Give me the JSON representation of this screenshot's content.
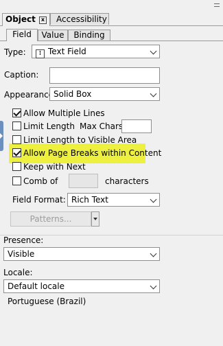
{
  "tabs": {
    "object": "Object",
    "close_glyph": "x",
    "accessibility": "Accessibility"
  },
  "subtabs": {
    "field": "Field",
    "value": "Value",
    "binding": "Binding"
  },
  "type": {
    "label": "Type:",
    "icon_glyph": "I",
    "value": "Text Field"
  },
  "caption": {
    "label": "Caption:",
    "value": ""
  },
  "appearance": {
    "label": "Appearance:",
    "value": "Solid Box"
  },
  "options": {
    "allow_multiple_lines": {
      "label": "Allow Multiple Lines",
      "checked": true
    },
    "limit_length": {
      "label": "Limit Length",
      "checked": false
    },
    "max_chars_label": "Max Chars:",
    "max_chars_value": "",
    "limit_visible": {
      "label": "Limit Length to Visible Area",
      "checked": false
    },
    "allow_page_breaks": {
      "label": "Allow Page Breaks within Content",
      "checked": true
    },
    "keep_with_next": {
      "label": "Keep with Next",
      "checked": false
    },
    "comb_of": {
      "label": "Comb of",
      "checked": false
    },
    "characters_label": "characters"
  },
  "field_format": {
    "label": "Field Format:",
    "value": "Rich Text"
  },
  "patterns_button": "Patterns...",
  "presence": {
    "label": "Presence:",
    "value": "Visible"
  },
  "locale": {
    "label": "Locale:",
    "value": "Default locale",
    "detail": "Portuguese (Brazil)"
  },
  "colors": {
    "highlight": "#eef040"
  }
}
